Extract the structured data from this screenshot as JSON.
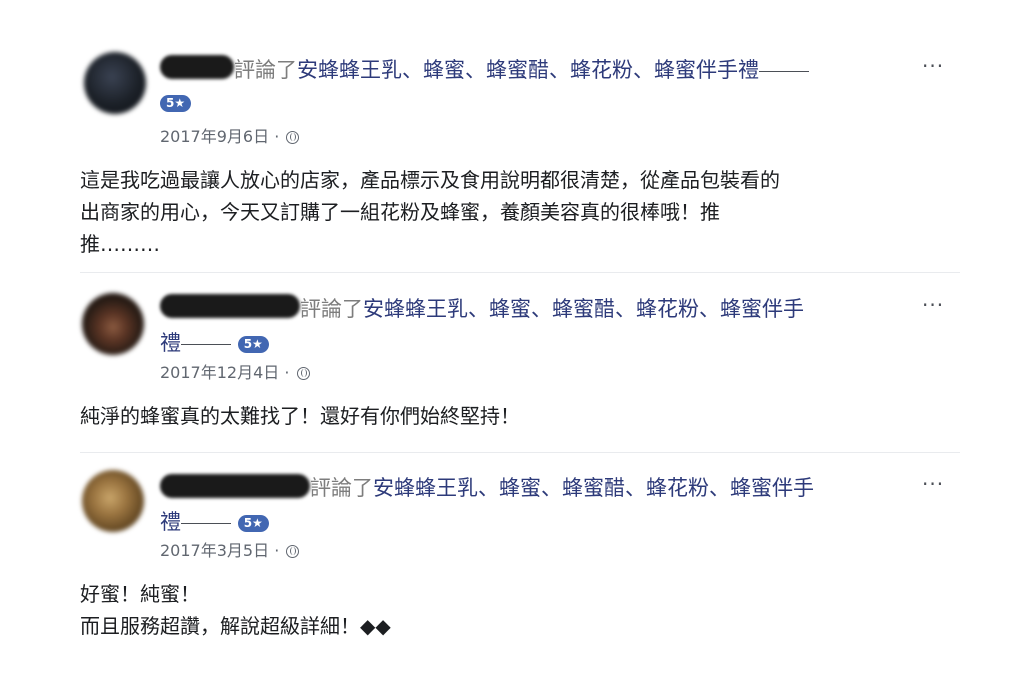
{
  "reviews": [
    {
      "verb": "評論了",
      "page_line1": "安蜂蜂王乳、蜂蜜、蜂蜜醋、蜂花粉、蜂蜜伴手禮",
      "page_line2": "",
      "rating": "5★",
      "date": "2017年9月6日",
      "dot": "·",
      "more": "···",
      "text": "這是我吃過最讓人放心的店家，產品標示及食用說明都很清楚，從產品包裝看的\n出商家的用心，今天又訂購了一組花粉及蜂蜜，養顏美容真的很棒哦！推\n推………",
      "avatar_color": "#1b2027"
    },
    {
      "verb": "評論了",
      "page_line1": "安蜂蜂王乳、蜂蜜、蜂蜜醋、蜂花粉、蜂蜜伴手",
      "page_line2": "禮",
      "rating": "5★",
      "date": "2017年12月4日",
      "dot": "·",
      "more": "···",
      "text": "純淨的蜂蜜真的太難找了！還好有你們始終堅持！",
      "avatar_color": "#2a1d16"
    },
    {
      "verb": "評論了",
      "page_line1": "安蜂蜂王乳、蜂蜜、蜂蜜醋、蜂花粉、蜂蜜伴手",
      "page_line2": "禮",
      "rating": "5★",
      "date": "2017年3月5日",
      "dot": "·",
      "more": "···",
      "text": "好蜜！純蜜！\n而且服務超讚，解說超級詳細！◆◆",
      "avatar_color": "#7a5a2a"
    }
  ]
}
